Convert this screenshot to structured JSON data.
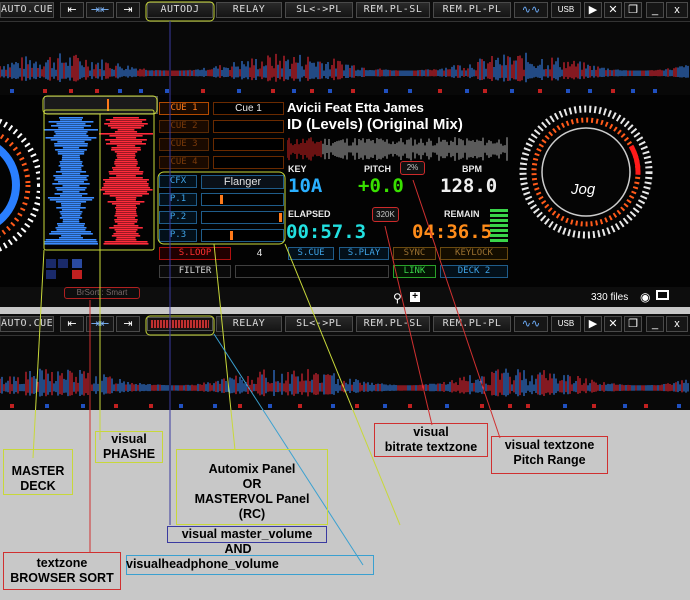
{
  "toolbar": {
    "automix_label": "AUTO.CUE",
    "prev_icon": "skip-back-icon",
    "sync_icon": "sync-icon",
    "next_icon": "skip-forward-icon",
    "autodj_label": "AUTODJ",
    "relay_label": "RELAY",
    "slpl_label": "SL<->PL",
    "rempl_sl_label": "REM.PL-SL",
    "rempl_pl_label": "REM.PL-PL",
    "usb_label": "USB",
    "minimize": "_",
    "close": "x"
  },
  "deck": {
    "artist": "Avicii Feat Etta James",
    "title": "ID (Levels) (Original Mix)",
    "cues": [
      "CUE 1",
      "CUE 2",
      "CUE 3",
      "CUE 4"
    ],
    "cue1_name": "Cue 1",
    "cfx_label": "CFX",
    "effect_name": "Flanger",
    "p_labels": [
      "P.1",
      "P.2",
      "P.3"
    ],
    "sloop_label": "S.LOOP",
    "loop_value": "4",
    "filter_label": "FILTER",
    "scue_label": "S.CUE",
    "splay_label": "S.PLAY",
    "sync_label": "SYNC",
    "keylock_label": "KEYLOCK",
    "link_label": "LINK",
    "deck_label": "DECK 2",
    "key_label": "KEY",
    "key_value": "10A",
    "pitch_label": "PITCH",
    "pitch_value": "+0.0",
    "pitch_range": "2%",
    "bpm_label": "BPM",
    "bpm_value": "128.0",
    "elapsed_label": "ELAPSED",
    "elapsed_value": "00:57.3",
    "bitrate": "320K",
    "remain_label": "REMAIN",
    "remain_value": "04:36.5",
    "jog_label": "Jog"
  },
  "browser": {
    "sort_text": "BrSort : Smart",
    "file_count": "330 files"
  },
  "annotations": {
    "master_deck": "MASTER\nDECK",
    "visual_phashe": "visual\nPHASHE",
    "automix_panel": "Automix Panel\nOR\nMASTERVOL Panel\n(RC)",
    "master_volume": "visual  master_volume",
    "and_text": "AND",
    "headphone_volume": "visualheadphone_volume",
    "bitrate_textzone": "visual\nbitrate textzone",
    "pitch_range_textzone": "visual textzone\nPitch Range",
    "browser_sort": "textzone\nBROWSER SORT"
  },
  "colors": {
    "wave_blue": "#3b8cff",
    "wave_red": "#ff2a3a",
    "cue_orange": "#ff7a1a",
    "key_blue": "#2ab0ff",
    "pitch_green": "#39e000",
    "elapsed_cyan": "#22e0e0",
    "remain_orange": "#ff8c1a"
  }
}
